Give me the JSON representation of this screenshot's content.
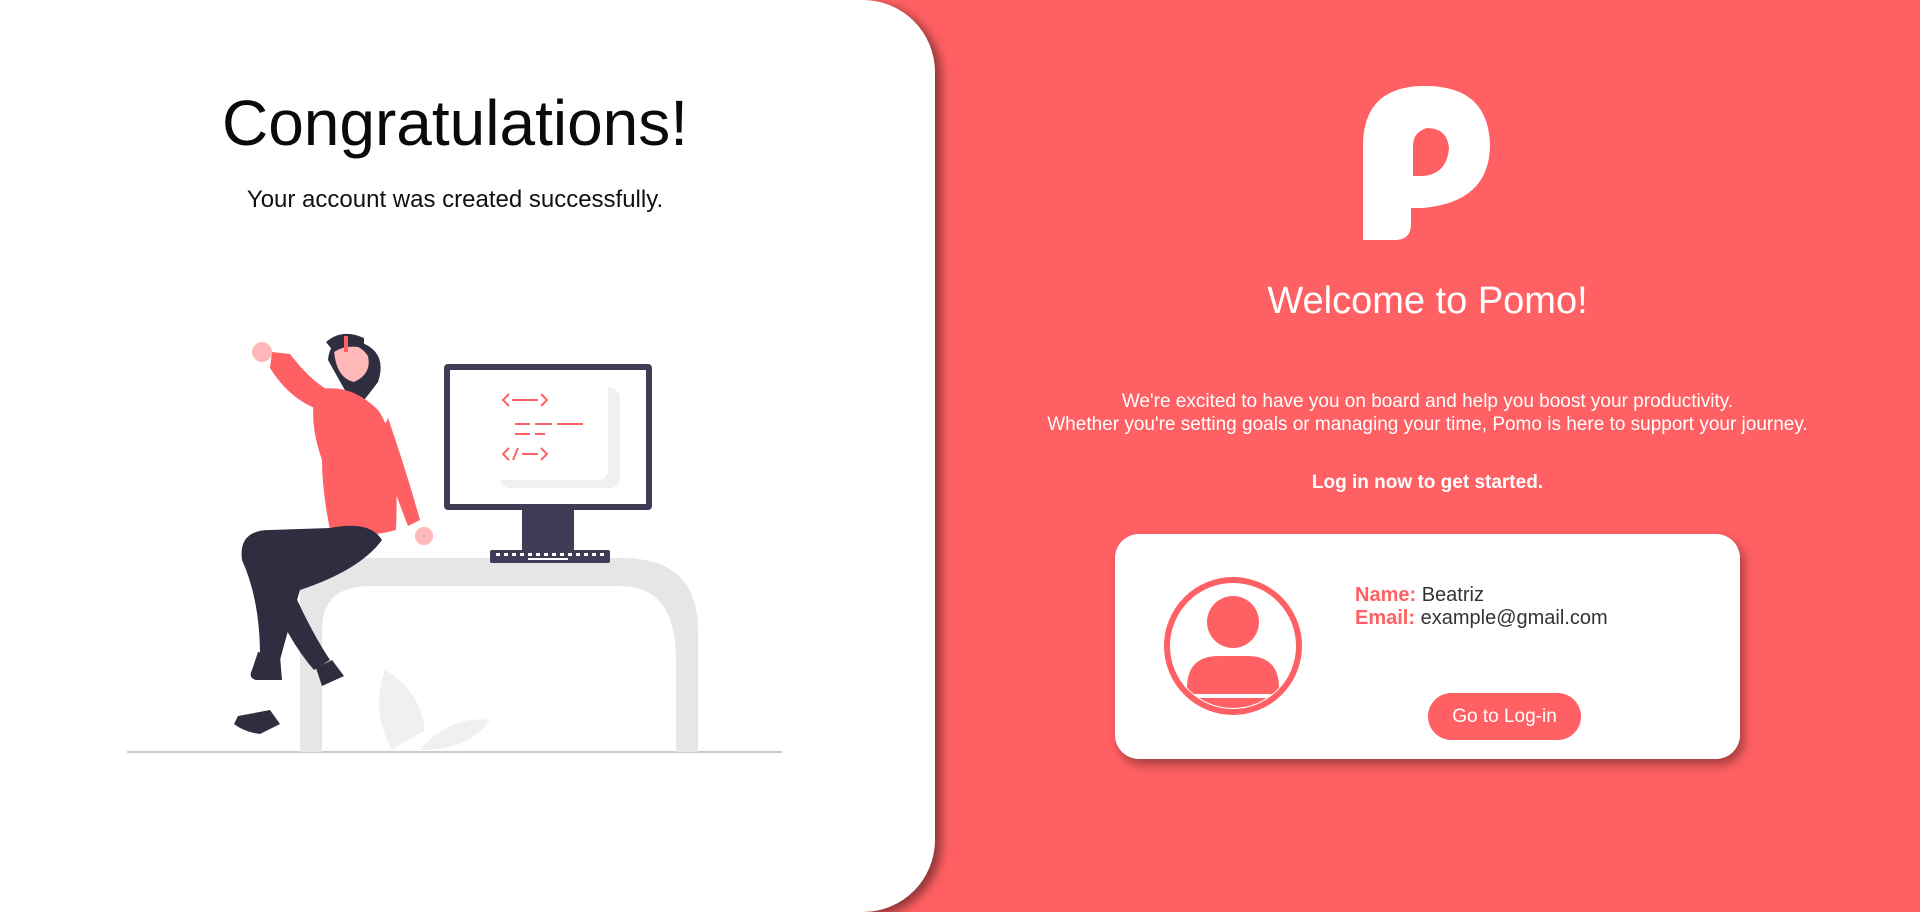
{
  "left": {
    "title": "Congratulations!",
    "subtitle": "Your account was created successfully.",
    "illustration_icon": "woman-at-computer-illustration"
  },
  "right": {
    "logo_icon": "pomo-p-logo-icon",
    "title": "Welcome to Pomo!",
    "intro_line1": "We're excited to have you on board and help you boost your productivity.",
    "intro_line2": "Whether you're setting goals or managing your time, Pomo is here to support your journey.",
    "cta": "Log in now to get started."
  },
  "card": {
    "avatar_icon": "user-avatar-icon",
    "name_label": "Name:",
    "name_value": "Beatriz",
    "email_label": "Email:",
    "email_value": "example@gmail.com",
    "login_button": "Go to Log-in"
  },
  "colors": {
    "accent": "#FF6063",
    "panel": "#FFFFFF",
    "dark": "#2F2E41"
  }
}
